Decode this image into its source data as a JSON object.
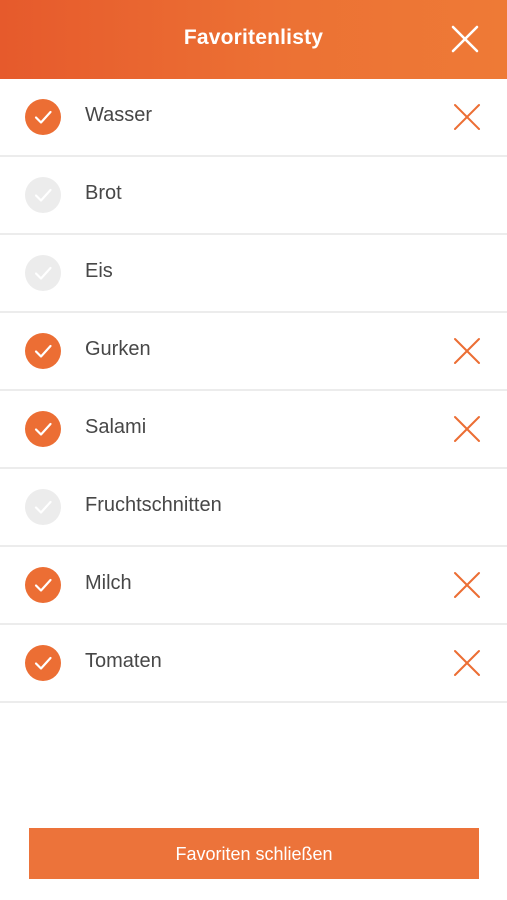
{
  "header": {
    "title": "Favoritenlisty",
    "close_icon": "close-icon"
  },
  "colors": {
    "accent": "#ec6e34",
    "unchecked": "#ececec",
    "text": "#474747"
  },
  "items": [
    {
      "label": "Wasser",
      "checked": true
    },
    {
      "label": "Brot",
      "checked": false
    },
    {
      "label": "Eis",
      "checked": false
    },
    {
      "label": "Gurken",
      "checked": true
    },
    {
      "label": "Salami",
      "checked": true
    },
    {
      "label": "Fruchtschnitten",
      "checked": false
    },
    {
      "label": "Milch",
      "checked": true
    },
    {
      "label": "Tomaten",
      "checked": true
    }
  ],
  "footer": {
    "button_label": "Favoriten schließen"
  }
}
